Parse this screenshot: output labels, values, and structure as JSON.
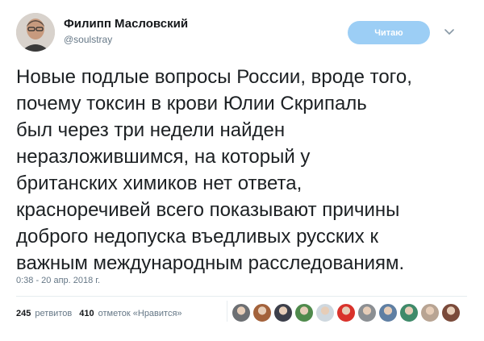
{
  "author": {
    "name": "Филипп Масловский",
    "handle": "@soulstray",
    "avatar_icon": "user-avatar"
  },
  "follow_button": {
    "label": "Читаю",
    "color": "#9ccef5"
  },
  "more_menu_icon": "chevron-down-icon",
  "tweet": {
    "text": "Новые подлые вопросы России, вроде того,\nпочему токсин в крови Юлии Скрипаль\nбыл через три недели найден\nнеразложившимся, на который у\nбританских химиков нет ответа,\nкрасноречивей всего показывают причины\nдоброго недопуска въедливых русских к\nважным международным расследованиям.",
    "timestamp": "0:38 - 20 апр. 2018 г."
  },
  "stats": {
    "retweets_count": "245",
    "retweets_label": "ретвитов",
    "likes_count": "410",
    "likes_label": "отметок «Нравится»"
  },
  "likers": [
    {
      "color": "#6c6f73"
    },
    {
      "color": "#a3623b"
    },
    {
      "color": "#3c3f4a"
    },
    {
      "color": "#4f8a4c"
    },
    {
      "color": "#cfd8df"
    },
    {
      "color": "#d9322b"
    },
    {
      "color": "#8b8f93"
    },
    {
      "color": "#5f7fa3"
    },
    {
      "color": "#3f8a6a"
    },
    {
      "color": "#b8a493"
    },
    {
      "color": "#7a4a3a"
    }
  ]
}
